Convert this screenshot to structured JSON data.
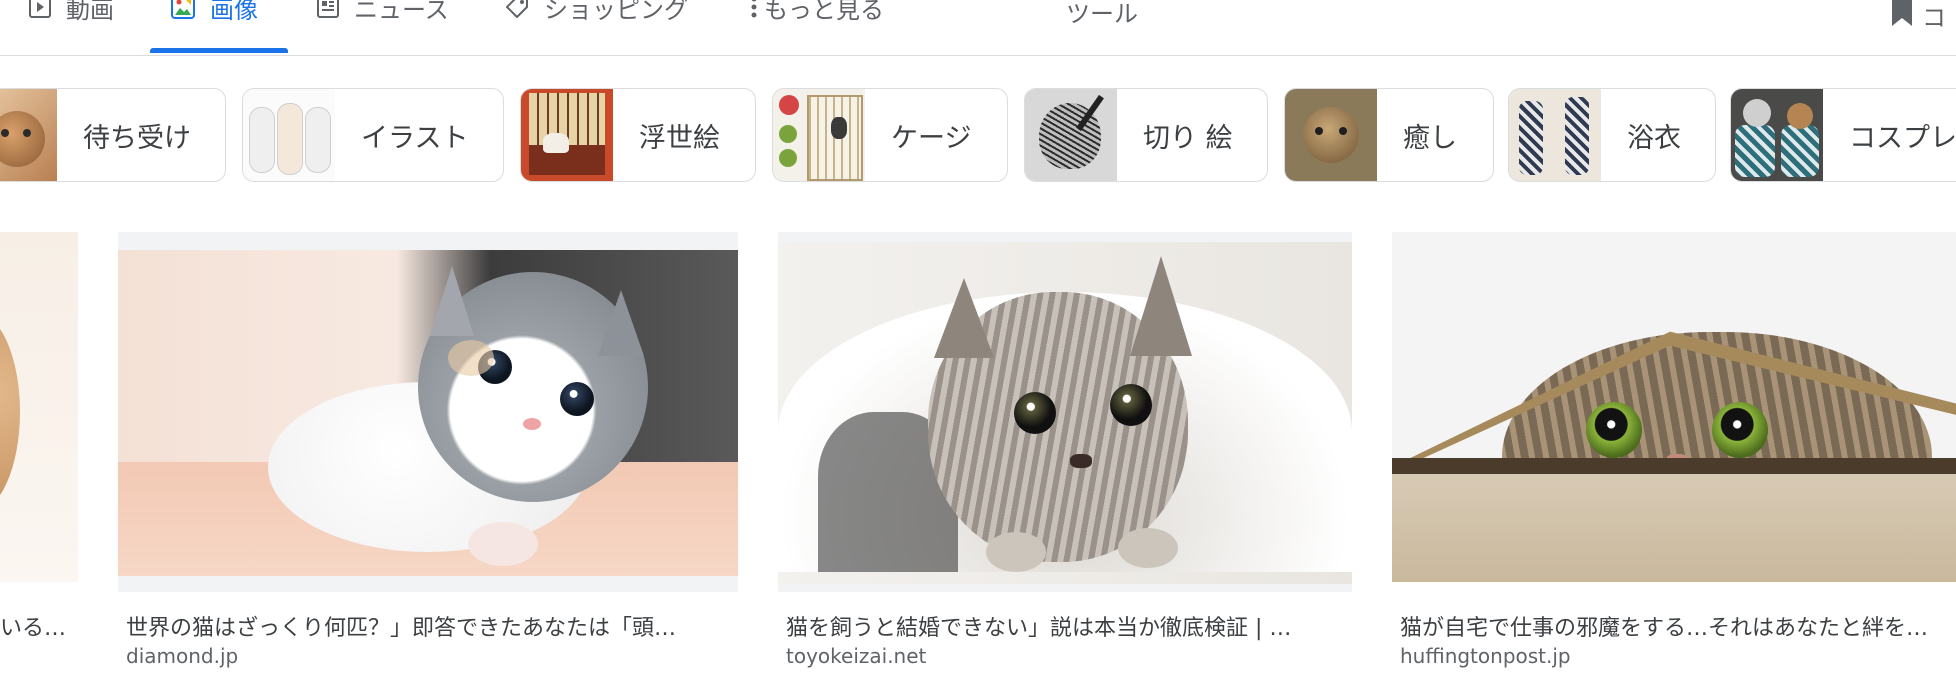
{
  "tabs": [
    {
      "label": "動画",
      "icon": "video-icon"
    },
    {
      "label": "画像",
      "icon": "image-icon",
      "active": true
    },
    {
      "label": "ニュース",
      "icon": "news-icon"
    },
    {
      "label": "ショッピング",
      "icon": "tag-icon"
    },
    {
      "label": "もっと見る",
      "icon": "more-vert-icon"
    }
  ],
  "tools_label": "ツール",
  "save_label": "コ",
  "chips": [
    {
      "label": "待ち受け"
    },
    {
      "label": "イラスト"
    },
    {
      "label": "浮世絵"
    },
    {
      "label": "ケージ"
    },
    {
      "label": "切り 絵"
    },
    {
      "label": "癒し"
    },
    {
      "label": "浴衣"
    },
    {
      "label": "コスプレ"
    }
  ],
  "results": [
    {
      "caption": "いる…",
      "source": ""
    },
    {
      "caption": "世界の猫はざっくり何匹？」即答できたあなたは「頭…",
      "source": "diamond.jp"
    },
    {
      "caption": "猫を飼うと結婚できない」説は本当か徹底検証 | …",
      "source": "toyokeizai.net"
    },
    {
      "caption": "猫が自宅で仕事の邪魔をする…それはあなたと絆を…",
      "source": "huffingtonpost.jp"
    }
  ],
  "colors": {
    "accent": "#1a73e8",
    "border": "#dadce0",
    "muted_text": "#5f6368"
  }
}
